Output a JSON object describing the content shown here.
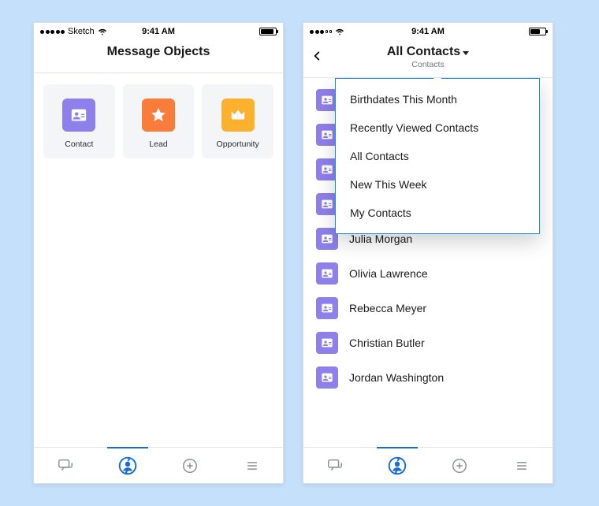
{
  "colors": {
    "background": "#c4e0fb",
    "icon_contact": "#8d80ea",
    "icon_lead": "#fa7c3b",
    "icon_opportunity": "#fcb12e",
    "accent_blue": "#176bd6",
    "popover_border": "#1e88e5"
  },
  "status_bar": {
    "carrier": "Sketch",
    "time": "9:41 AM"
  },
  "phone_left": {
    "title": "Message Objects",
    "tiles": [
      {
        "label": "Contact",
        "icon": "contact-card-icon"
      },
      {
        "label": "Lead",
        "icon": "star-icon"
      },
      {
        "label": "Opportunity",
        "icon": "crown-icon"
      }
    ]
  },
  "phone_right": {
    "title": "All Contacts",
    "subtitle": "Contacts",
    "dropdown_items": [
      "Birthdates This Month",
      "Recently Viewed Contacts",
      "All Contacts",
      "New This Week",
      "My Contacts"
    ],
    "contacts": [
      "",
      "",
      "",
      "",
      "Julia Morgan",
      "Olivia Lawrence",
      "Rebecca Meyer",
      "Christian Butler",
      "Jordan Washington"
    ]
  },
  "tabbar": {
    "tabs": [
      "chat",
      "contacts",
      "add",
      "menu"
    ],
    "active_index": 1
  }
}
